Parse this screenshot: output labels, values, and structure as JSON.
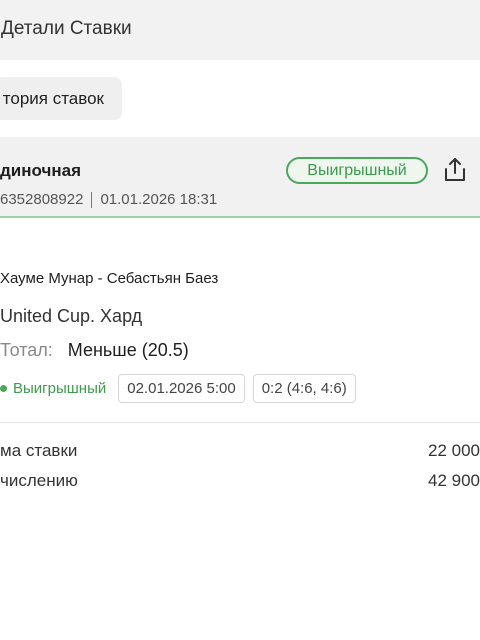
{
  "header": {
    "title": "Детали Ставки"
  },
  "history_button": {
    "label": "тория ставок"
  },
  "bet": {
    "type": "диночная",
    "status": "Выигрышный",
    "id": "6352808922",
    "datetime": "01.01.2026 18:31"
  },
  "event": {
    "match": "Хауме Мунар - Себастьян Баез",
    "tournament": "United Cup. Хард",
    "total_label": "Тотал:",
    "total_value": "Меньше (20.5)",
    "status": "Выигрышный",
    "date": "02.01.2026 5:00",
    "score": "0:2 (4:6, 4:6)"
  },
  "summary": [
    {
      "label": "ма ставки",
      "value": "22 000"
    },
    {
      "label": "числению",
      "value": "42 900"
    }
  ],
  "colors": {
    "win_green": "#3d9b4e",
    "header_bg": "#f2f2f2"
  },
  "icons": {
    "share": "share-icon"
  }
}
